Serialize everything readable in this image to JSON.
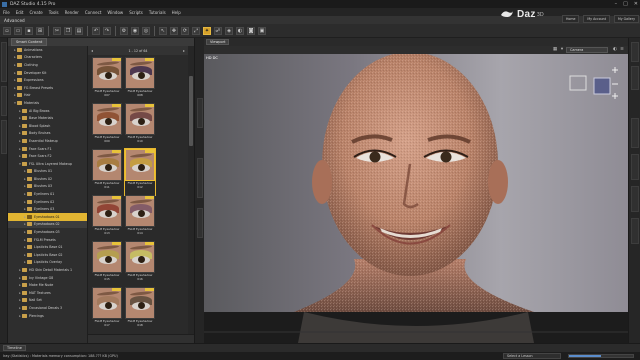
{
  "app": {
    "title": "DAZ Studio 4.15 Pro"
  },
  "menu": [
    "File",
    "Edit",
    "Create",
    "Tools",
    "Render",
    "Connect",
    "Window",
    "Scripts",
    "Tutorials",
    "Help"
  ],
  "mode_tab": "Advanced",
  "brand": {
    "name": "Daz",
    "suffix": "3D"
  },
  "top_links": [
    "Home",
    "My Account",
    "My Gallery"
  ],
  "content_panel": {
    "tab_label": "Smart Content",
    "page_indicator": "1 - 12 of 64",
    "tree": [
      {
        "label": "Animations",
        "depth": 1,
        "expanded": false
      },
      {
        "label": "Characters",
        "depth": 1,
        "expanded": false
      },
      {
        "label": "Clothing",
        "depth": 1,
        "expanded": false
      },
      {
        "label": "Developer Kit",
        "depth": 1,
        "expanded": false
      },
      {
        "label": "Expressions",
        "depth": 1,
        "expanded": false
      },
      {
        "label": "FG Breast Presets",
        "depth": 1,
        "expanded": false
      },
      {
        "label": "Hair",
        "depth": 1,
        "expanded": false
      },
      {
        "label": "Materials",
        "depth": 1,
        "expanded": true
      },
      {
        "label": "Al Big Brows",
        "depth": 2,
        "expanded": false
      },
      {
        "label": "Base Materials",
        "depth": 2,
        "expanded": false
      },
      {
        "label": "Blood Splash",
        "depth": 2,
        "expanded": false
      },
      {
        "label": "Body Bruises",
        "depth": 2,
        "expanded": false
      },
      {
        "label": "Essential Makeup",
        "depth": 2,
        "expanded": false
      },
      {
        "label": "Face Scars F1",
        "depth": 2,
        "expanded": false
      },
      {
        "label": "Face Scars F2",
        "depth": 2,
        "expanded": false
      },
      {
        "label": "FSL Ultra Layered Makeup",
        "depth": 2,
        "expanded": true
      },
      {
        "label": "Blushes 01",
        "depth": 3,
        "expanded": false
      },
      {
        "label": "Blushes 02",
        "depth": 3,
        "expanded": false
      },
      {
        "label": "Blushes 03",
        "depth": 3,
        "expanded": false
      },
      {
        "label": "Eyeliners 01",
        "depth": 3,
        "expanded": false
      },
      {
        "label": "Eyeliners 02",
        "depth": 3,
        "expanded": false
      },
      {
        "label": "Eyeliners 03",
        "depth": 3,
        "expanded": false
      },
      {
        "label": "Eyeshadows 01",
        "depth": 3,
        "expanded": false,
        "selected": true
      },
      {
        "label": "Eyeshadows 02",
        "depth": 3,
        "expanded": false,
        "hover": true
      },
      {
        "label": "Eyeshadows 03",
        "depth": 3,
        "expanded": false
      },
      {
        "label": "FSLM Presets",
        "depth": 3,
        "expanded": false
      },
      {
        "label": "Lipsticks Base 01",
        "depth": 3,
        "expanded": false
      },
      {
        "label": "Lipsticks Base 02",
        "depth": 3,
        "expanded": false
      },
      {
        "label": "Lipsticks Overlay",
        "depth": 3,
        "expanded": false
      },
      {
        "label": "HD Skin Detail Materials 1",
        "depth": 2,
        "expanded": false
      },
      {
        "label": "Ivy Vintage G8",
        "depth": 2,
        "expanded": false
      },
      {
        "label": "Make Me Nude",
        "depth": 2,
        "expanded": false
      },
      {
        "label": "MAT Textures",
        "depth": 2,
        "expanded": false
      },
      {
        "label": "Nail Set",
        "depth": 2,
        "expanded": false
      },
      {
        "label": "Occasional Decals 3",
        "depth": 2,
        "expanded": false
      },
      {
        "label": "Piercings",
        "depth": 2,
        "expanded": false
      }
    ],
    "thumbnails": [
      {
        "caption": "FSLM Eyeshadow 007",
        "lid_color": "#6b4a2e",
        "selected": false
      },
      {
        "caption": "FSLM Eyeshadow 008",
        "lid_color": "#3b2a4a",
        "selected": false
      },
      {
        "caption": "FSLM Eyeshadow 009",
        "lid_color": "#8a4a2a",
        "selected": false
      },
      {
        "caption": "FSLM Eyeshadow 010",
        "lid_color": "#6a4040",
        "selected": false
      },
      {
        "caption": "FSLM Eyeshadow 011",
        "lid_color": "#a67b3a",
        "selected": false
      },
      {
        "caption": "FSLM Eyeshadow 012",
        "lid_color": "#c7a13a",
        "selected": true
      },
      {
        "caption": "FSLM Eyeshadow 013",
        "lid_color": "#8c3a2c",
        "selected": false
      },
      {
        "caption": "FSLM Eyeshadow 014",
        "lid_color": "#7a5566",
        "selected": false
      },
      {
        "caption": "FSLM Eyeshadow 015",
        "lid_color": "#b5a24a",
        "selected": false
      },
      {
        "caption": "FSLM Eyeshadow 016",
        "lid_color": "#c8c660",
        "selected": false
      },
      {
        "caption": "FSLM Eyeshadow 017",
        "lid_color": "#a0785a",
        "selected": false
      },
      {
        "caption": "FSLM Eyeshadow 018",
        "lid_color": "#5a4a3a",
        "selected": false
      }
    ]
  },
  "viewport": {
    "tab_label": "Viewport",
    "camera": "Camera",
    "label": "HD DC"
  },
  "timeline_tab": "Timeline",
  "status": {
    "message": "Iray (Statistics) : Materials memory consumption: 188.7?? KB (GPU)",
    "lesson": "Select a Lesson",
    "progress": 0.5
  },
  "colors": {
    "accent": "#e2b532",
    "viewport_bg": "#8f8c95"
  },
  "icons": [
    "save-icon",
    "undo-icon",
    "redo-icon",
    "camera-icon",
    "render-icon",
    "move-icon",
    "rotate-icon",
    "scale-icon",
    "node-select-icon"
  ]
}
